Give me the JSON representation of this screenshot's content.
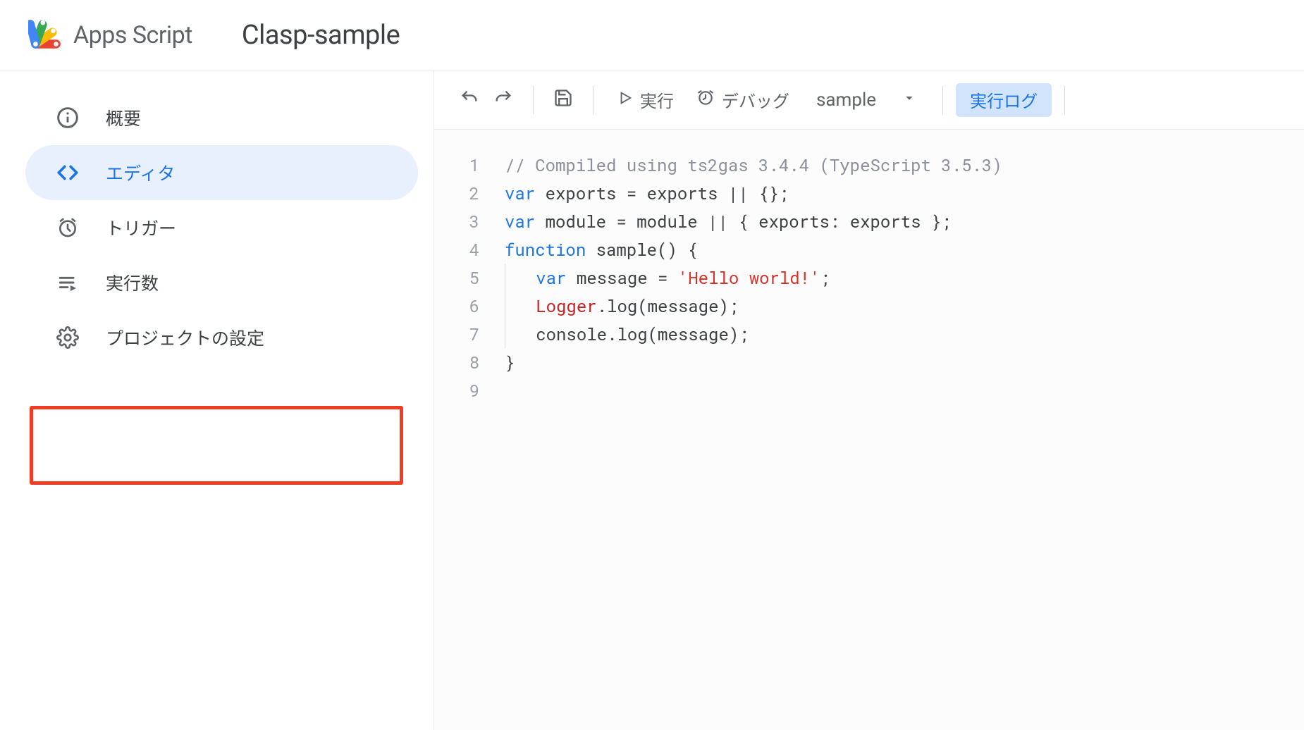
{
  "header": {
    "product": "Apps Script",
    "project_title": "Clasp-sample"
  },
  "sidebar": {
    "items": [
      {
        "key": "overview",
        "label": "概要",
        "icon": "info-icon",
        "active": false
      },
      {
        "key": "editor",
        "label": "エディタ",
        "icon": "code-icon",
        "active": true
      },
      {
        "key": "triggers",
        "label": "トリガー",
        "icon": "alarm-icon",
        "active": false
      },
      {
        "key": "executions",
        "label": "実行数",
        "icon": "playlist-icon",
        "active": false
      },
      {
        "key": "settings",
        "label": "プロジェクトの設定",
        "icon": "gear-icon",
        "active": false,
        "highlighted": true
      }
    ]
  },
  "toolbar": {
    "undo_title": "元に戻す",
    "redo_title": "やり直し",
    "save_title": "保存",
    "run_label": "実行",
    "debug_label": "デバッグ",
    "function_selected": "sample",
    "exec_log_label": "実行ログ"
  },
  "editor": {
    "lines": [
      {
        "n": 1,
        "tokens": [
          {
            "t": "// Compiled using ts2gas 3.4.4 (TypeScript 3.5.3)",
            "c": "comment"
          }
        ]
      },
      {
        "n": 2,
        "tokens": [
          {
            "t": "var",
            "c": "kw"
          },
          {
            "t": " exports = exports || {};",
            "c": "plain"
          }
        ]
      },
      {
        "n": 3,
        "tokens": [
          {
            "t": "var",
            "c": "kw"
          },
          {
            "t": " module = module || { exports: exports };",
            "c": "plain"
          }
        ]
      },
      {
        "n": 4,
        "tokens": [
          {
            "t": "function",
            "c": "kw"
          },
          {
            "t": " sample() {",
            "c": "plain"
          }
        ]
      },
      {
        "n": 5,
        "indent": 1,
        "tokens": [
          {
            "t": "var",
            "c": "kw"
          },
          {
            "t": " message = ",
            "c": "plain"
          },
          {
            "t": "'Hello world!'",
            "c": "str"
          },
          {
            "t": ";",
            "c": "plain"
          }
        ]
      },
      {
        "n": 6,
        "indent": 1,
        "tokens": [
          {
            "t": "Logger",
            "c": "obj"
          },
          {
            "t": ".log(message);",
            "c": "plain"
          }
        ]
      },
      {
        "n": 7,
        "indent": 1,
        "tokens": [
          {
            "t": "console.log(message);",
            "c": "plain"
          }
        ]
      },
      {
        "n": 8,
        "tokens": [
          {
            "t": "}",
            "c": "plain"
          }
        ]
      },
      {
        "n": 9,
        "tokens": [
          {
            "t": "",
            "c": "plain"
          }
        ]
      }
    ]
  }
}
